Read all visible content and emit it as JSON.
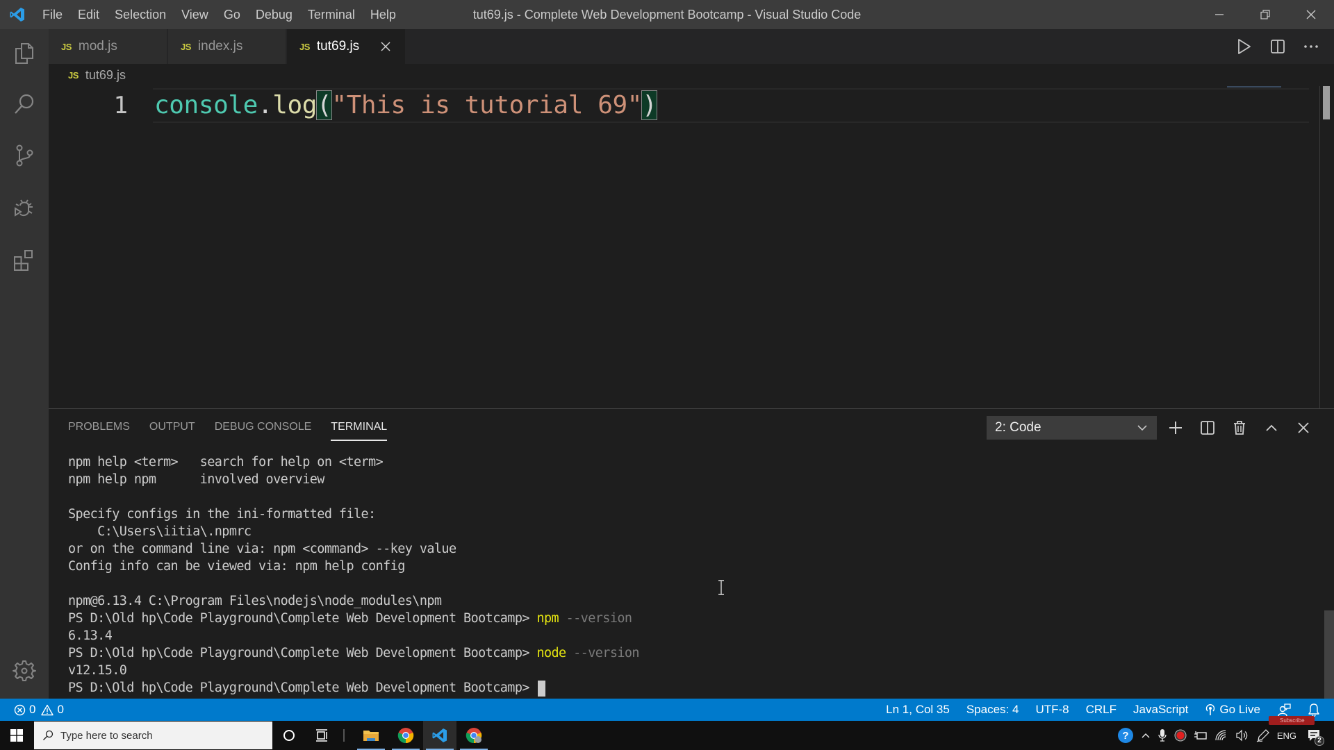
{
  "window": {
    "title": "tut69.js - Complete Web Development Bootcamp - Visual Studio Code",
    "menu": [
      "File",
      "Edit",
      "Selection",
      "View",
      "Go",
      "Debug",
      "Terminal",
      "Help"
    ],
    "controls": [
      "minimize-icon",
      "restore-icon",
      "close-icon"
    ]
  },
  "activity_bar": {
    "items": [
      {
        "id": "explorer",
        "icon": "files-icon"
      },
      {
        "id": "search",
        "icon": "search-icon"
      },
      {
        "id": "source-control",
        "icon": "source-control-icon"
      },
      {
        "id": "debug",
        "icon": "debug-icon"
      },
      {
        "id": "extensions",
        "icon": "extensions-icon"
      }
    ],
    "bottom": {
      "id": "manage",
      "icon": "gear-icon"
    }
  },
  "tabs": [
    {
      "badge": "JS",
      "label": "mod.js",
      "active": false
    },
    {
      "badge": "JS",
      "label": "index.js",
      "active": false
    },
    {
      "badge": "JS",
      "label": "tut69.js",
      "active": true
    }
  ],
  "editor_actions": [
    "run-icon",
    "split-editor-icon",
    "more-actions-icon"
  ],
  "breadcrumb": {
    "badge": "JS",
    "file": "tut69.js"
  },
  "editor": {
    "lines": [
      {
        "number": "1",
        "tokens": {
          "object": "console",
          "dot": ".",
          "method": "log",
          "open_paren": "(",
          "string": "\"This is tutorial 69\"",
          "close_paren": ")"
        }
      }
    ]
  },
  "panel": {
    "tabs": [
      {
        "label": "PROBLEMS",
        "active": false
      },
      {
        "label": "OUTPUT",
        "active": false
      },
      {
        "label": "DEBUG CONSOLE",
        "active": false
      },
      {
        "label": "TERMINAL",
        "active": true
      }
    ],
    "terminal_select": "2: Code",
    "actions": [
      "new-terminal-icon",
      "split-terminal-icon",
      "kill-terminal-icon",
      "maximize-panel-icon",
      "close-panel-icon"
    ],
    "terminal_lines": [
      {
        "text": "npm help <term>   search for help on <term>"
      },
      {
        "text": "npm help npm      involved overview"
      },
      {
        "text": ""
      },
      {
        "text": "Specify configs in the ini-formatted file:"
      },
      {
        "text": "    C:\\Users\\iitia\\.npmrc"
      },
      {
        "text": "or on the command line via: npm <command> --key value"
      },
      {
        "text": "Config info can be viewed via: npm help config"
      },
      {
        "text": ""
      },
      {
        "text": "npm@6.13.4 C:\\Program Files\\nodejs\\node_modules\\npm"
      },
      {
        "prompt": "PS D:\\Old hp\\Code Playground\\Complete Web Development Bootcamp> ",
        "cmd": "npm",
        "arg": " --version"
      },
      {
        "text": "6.13.4"
      },
      {
        "prompt": "PS D:\\Old hp\\Code Playground\\Complete Web Development Bootcamp> ",
        "cmd": "node",
        "arg": " --version"
      },
      {
        "text": "v12.15.0"
      },
      {
        "prompt": "PS D:\\Old hp\\Code Playground\\Complete Web Development Bootcamp> ",
        "cursor": true
      }
    ]
  },
  "status_bar": {
    "errors": "0",
    "warnings": "0",
    "position": "Ln 1, Col 35",
    "indent": "Spaces: 4",
    "encoding": "UTF-8",
    "eol": "CRLF",
    "language": "JavaScript",
    "go_live": "Go Live",
    "color": "#007acc"
  },
  "taskbar": {
    "search_placeholder": "Type here to search",
    "language": "ENG",
    "notifications_count": "2",
    "overlay_badge": "Subscribe"
  }
}
